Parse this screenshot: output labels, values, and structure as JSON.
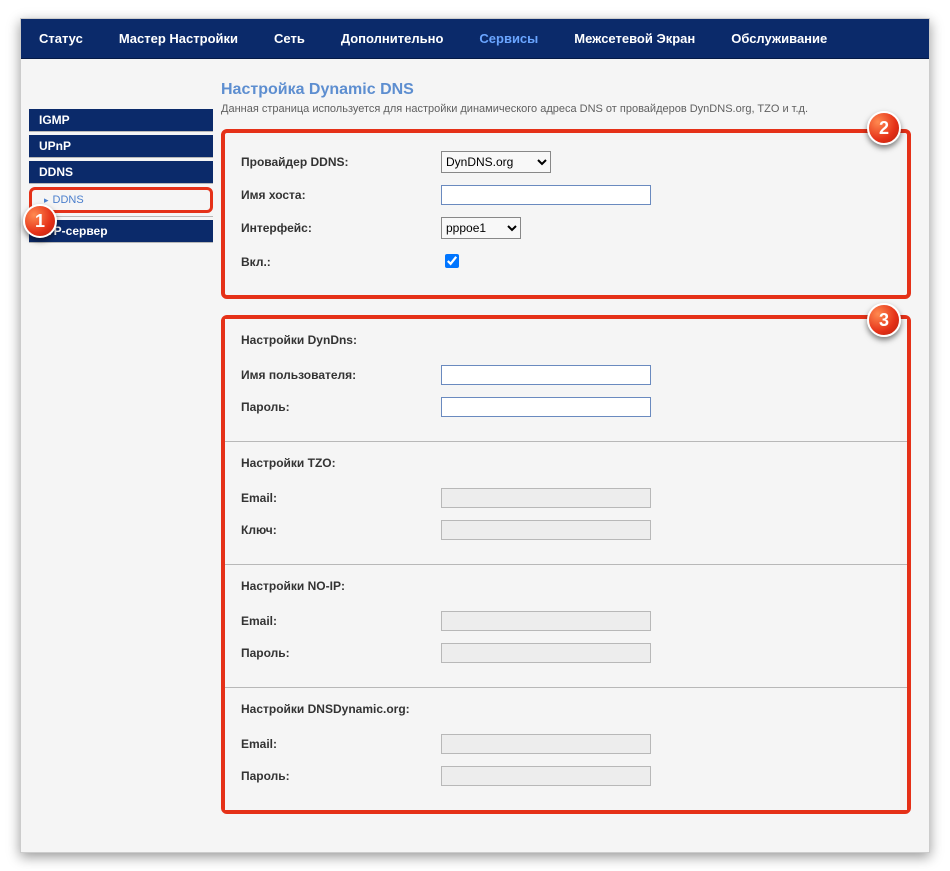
{
  "nav": {
    "items": [
      {
        "label": "Статус"
      },
      {
        "label": "Мастер Настройки"
      },
      {
        "label": "Сеть"
      },
      {
        "label": "Дополнительно"
      },
      {
        "label": "Сервисы",
        "active": true
      },
      {
        "label": "Межсетевой Экран"
      },
      {
        "label": "Обслуживание"
      }
    ]
  },
  "sidebar": {
    "items": [
      {
        "label": "IGMP"
      },
      {
        "label": "UPnP"
      },
      {
        "label": "DDNS"
      }
    ],
    "sub": {
      "label": "DDNS"
    },
    "last": {
      "label": "FTP-сервер"
    }
  },
  "page": {
    "title": "Настройка Dynamic DNS",
    "desc": "Данная страница используется для настройки динамического адреса DNS от провайдеров DynDNS.org, TZO и т.д."
  },
  "main_form": {
    "provider_label": "Провайдер DDNS:",
    "provider_value": "DynDNS.org",
    "hostname_label": "Имя хоста:",
    "hostname_value": "",
    "interface_label": "Интерфейс:",
    "interface_value": "pppoe1",
    "enable_label": "Вкл.:",
    "enable_checked": true
  },
  "sections": [
    {
      "title": "Настройки DynDns:",
      "rows": [
        {
          "label": "Имя пользователя:",
          "value": "",
          "disabled": false
        },
        {
          "label": "Пароль:",
          "value": "",
          "disabled": false
        }
      ]
    },
    {
      "title": "Настройки TZO:",
      "rows": [
        {
          "label": "Email:",
          "value": "",
          "disabled": true
        },
        {
          "label": "Ключ:",
          "value": "",
          "disabled": true
        }
      ]
    },
    {
      "title": "Настройки NO-IP:",
      "rows": [
        {
          "label": "Email:",
          "value": "",
          "disabled": true
        },
        {
          "label": "Пароль:",
          "value": "",
          "disabled": true
        }
      ]
    },
    {
      "title": "Настройки DNSDynamic.org:",
      "rows": [
        {
          "label": "Email:",
          "value": "",
          "disabled": true
        },
        {
          "label": "Пароль:",
          "value": "",
          "disabled": true
        }
      ]
    }
  ],
  "badges": {
    "b1": "1",
    "b2": "2",
    "b3": "3"
  }
}
